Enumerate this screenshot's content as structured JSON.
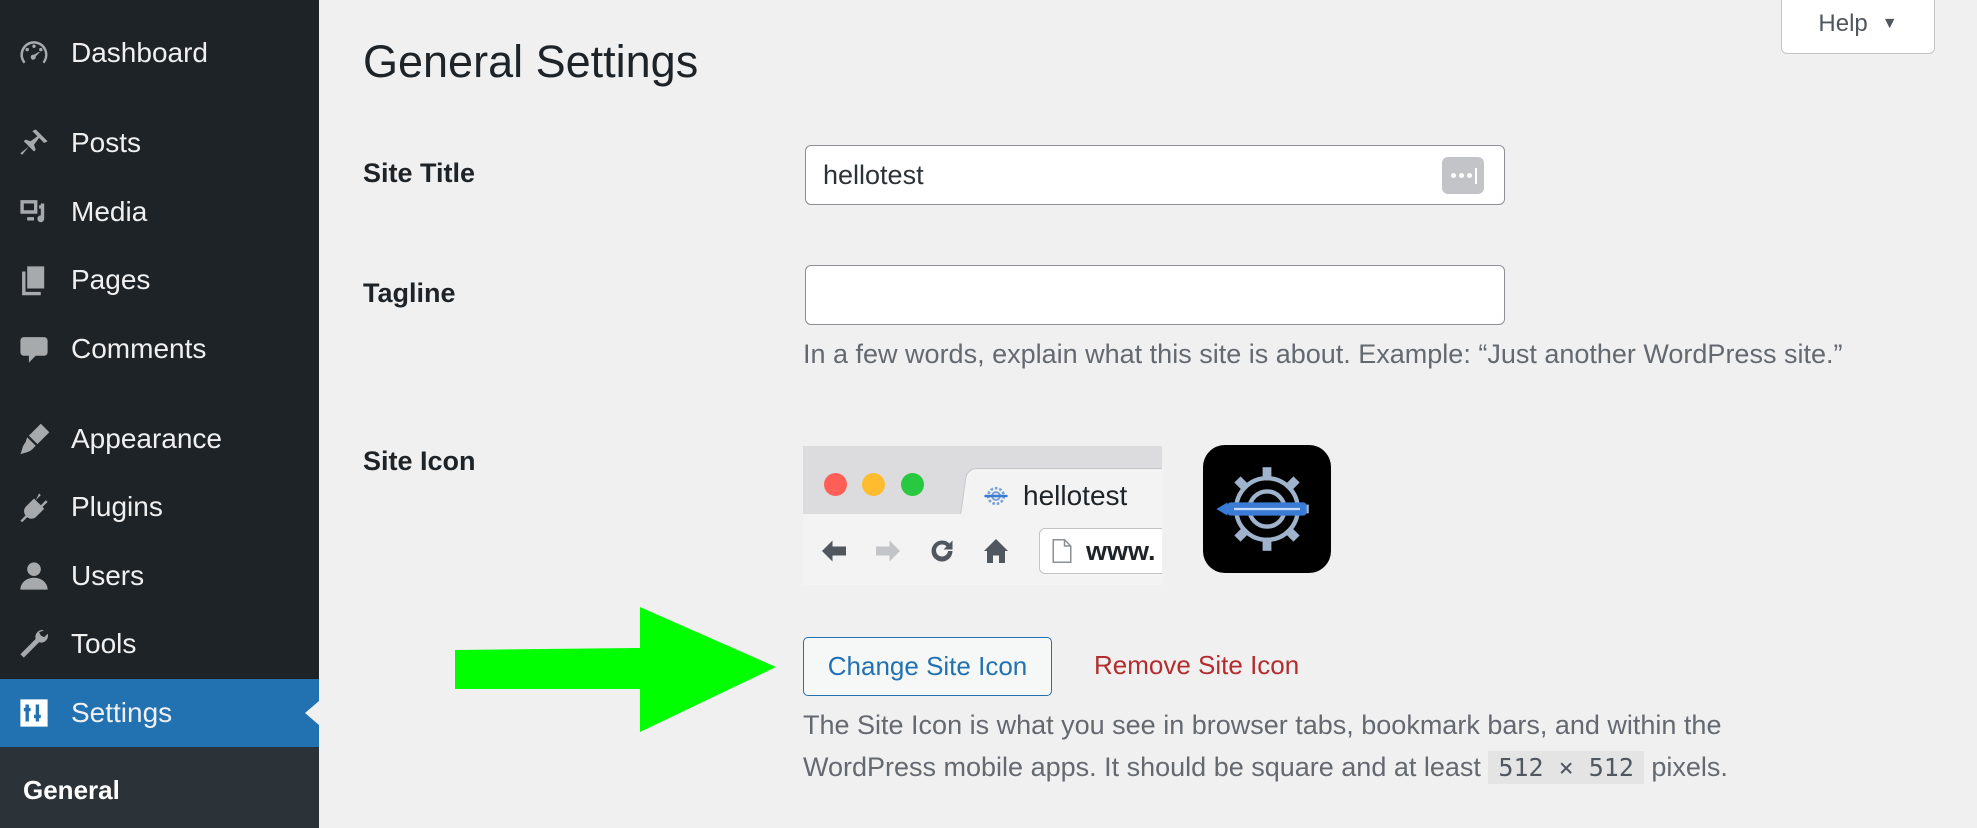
{
  "sidebar": {
    "items": [
      {
        "label": "Dashboard",
        "icon": "dashboard-icon"
      },
      {
        "label": "Posts",
        "icon": "pin-icon"
      },
      {
        "label": "Media",
        "icon": "media-icon"
      },
      {
        "label": "Pages",
        "icon": "pages-icon"
      },
      {
        "label": "Comments",
        "icon": "comment-icon"
      },
      {
        "label": "Appearance",
        "icon": "brush-icon"
      },
      {
        "label": "Plugins",
        "icon": "plug-icon"
      },
      {
        "label": "Users",
        "icon": "user-icon"
      },
      {
        "label": "Tools",
        "icon": "wrench-icon"
      },
      {
        "label": "Settings",
        "icon": "settings-sliders-icon",
        "active": true
      }
    ],
    "submenu": {
      "label": "General"
    }
  },
  "help": {
    "label": "Help"
  },
  "page": {
    "title": "General Settings"
  },
  "fields": {
    "site_title": {
      "label": "Site Title",
      "value": "hellotest"
    },
    "tagline": {
      "label": "Tagline",
      "value": "",
      "description": "In a few words, explain what this site is about. Example: “Just another WordPress site.”"
    },
    "site_icon": {
      "label": "Site Icon",
      "preview": {
        "tab_title": "hellotest",
        "url_text": "www."
      },
      "change_button": "Change Site Icon",
      "remove_button": "Remove Site Icon",
      "description_line1": "The Site Icon is what you see in browser tabs, bookmark bars, and within the",
      "description_line2_pre": "WordPress mobile apps. It should be square and at least",
      "description_code": "512 × 512",
      "description_line2_post": "pixels."
    }
  },
  "colors": {
    "sidebar_bg": "#1d2327",
    "accent": "#2271b1",
    "danger": "#b32d2e",
    "annotation_arrow": "#00ff00"
  }
}
